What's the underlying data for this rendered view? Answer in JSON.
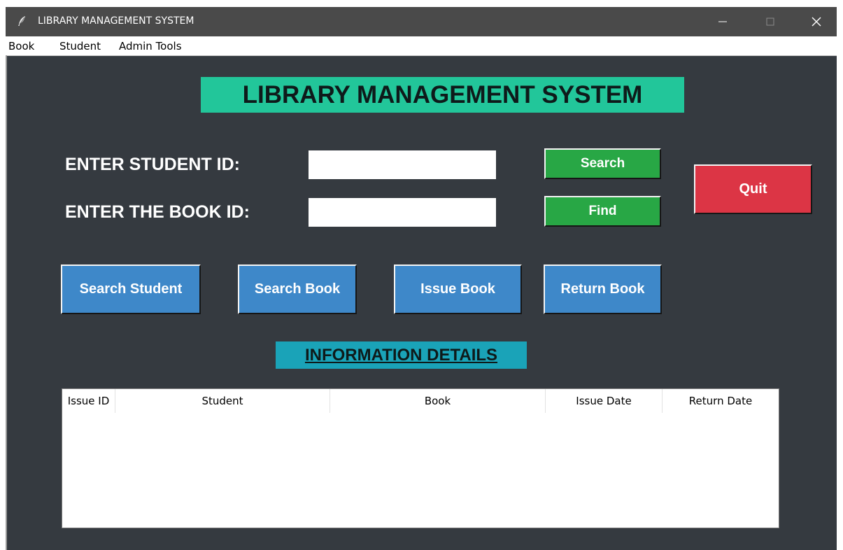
{
  "window": {
    "title": "LIBRARY MANAGEMENT SYSTEM",
    "controls": [
      "minimize-icon",
      "maximize-icon",
      "close-icon"
    ]
  },
  "menu": {
    "items": [
      "Book",
      "Student",
      "Admin Tools"
    ]
  },
  "main": {
    "title": "LIBRARY MANAGEMENT SYSTEM",
    "student_label": "ENTER STUDENT ID:",
    "book_label": "ENTER THE BOOK ID:",
    "student_value": "",
    "book_value": "",
    "search_label": "Search",
    "find_label": "Find",
    "quit_label": "Quit",
    "actions": [
      "Search Student",
      "Search Book",
      "Issue Book",
      "Return Book"
    ]
  },
  "info": {
    "title": "INFORMATION DETAILS",
    "columns": [
      "Issue ID",
      "Student",
      "Book",
      "Issue Date",
      "Return Date"
    ],
    "rows": []
  },
  "colors": {
    "background": "#353a40",
    "title_bg": "#22c69a",
    "info_bg": "#1aa3b8",
    "green": "#28a745",
    "red": "#dc3545",
    "blue": "#3e88c9"
  }
}
